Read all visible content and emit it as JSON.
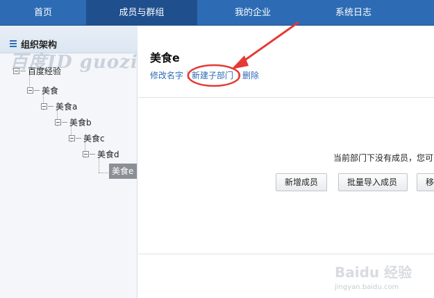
{
  "nav": {
    "items": [
      {
        "label": "首页",
        "active": false
      },
      {
        "label": "成员与群组",
        "active": true
      },
      {
        "label": "我的企业",
        "active": false
      },
      {
        "label": "系统日志",
        "active": false
      }
    ]
  },
  "sidebar": {
    "title": "组织架构",
    "watermark": "百度ID guozi",
    "tree": [
      "百度经验",
      "美食",
      "美食a",
      "美食b",
      "美食c",
      "美食d",
      "美食e"
    ],
    "selected": "美食e"
  },
  "main": {
    "title": "美食e",
    "actions": {
      "rename": "修改名字",
      "new_subdept": "新建子部门",
      "delete": "删除"
    },
    "empty_message": "当前部门下没有成员，您可",
    "buttons": {
      "add_member": "新增成员",
      "bulk_import": "批量导入成员",
      "move": "移"
    }
  },
  "annotation": {
    "color": "#e53935"
  },
  "brand": {
    "logo": "Baidu 经验",
    "url": "jingyan.baidu.com"
  }
}
